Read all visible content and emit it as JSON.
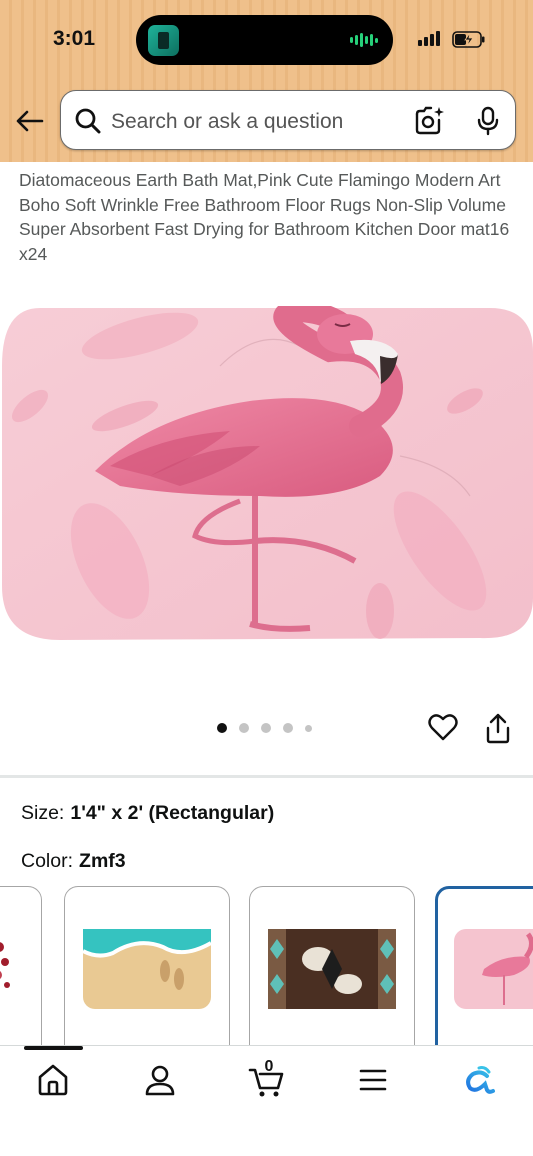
{
  "status_bar": {
    "time": "3:01"
  },
  "search": {
    "placeholder": "Search or ask a question"
  },
  "product": {
    "title": "Diatomaceous Earth Bath Mat,Pink Cute Flamingo Modern Art Boho Soft Wrinkle Free Bathroom Floor Rugs Non-Slip Volume Super Absorbent Fast Drying for Bathroom Kitchen Door mat16 x24",
    "image_count": 5,
    "active_image_index": 0
  },
  "options": {
    "size_label": "Size:",
    "size_value": "1'4\" x 2' (Rectangular)",
    "color_label": "Color:",
    "color_value": "Zmf3"
  },
  "swatches": [
    {
      "name": "red-pattern-mat"
    },
    {
      "name": "beach-footprints-mat"
    },
    {
      "name": "cowhide-aztec-mat"
    },
    {
      "name": "pink-flamingo-mat",
      "selected": true
    }
  ],
  "bottom_nav": {
    "items": [
      "home-icon",
      "account-icon",
      "cart-icon",
      "menu-icon",
      "rufus-icon"
    ],
    "cart_count": "0"
  },
  "colors": {
    "header": "#efc08b",
    "accent": "#2162a1",
    "flamingo": "#e26d8f"
  }
}
